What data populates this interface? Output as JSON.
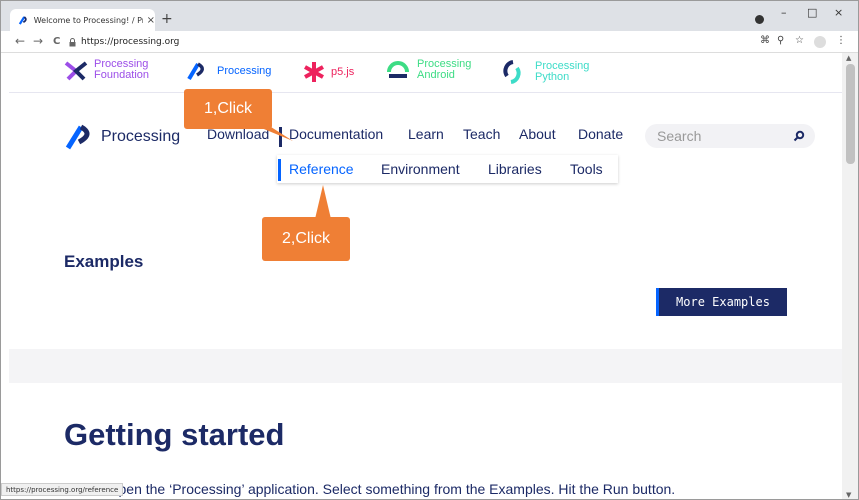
{
  "browser": {
    "tab_title": "Welcome to Processing! / Proce",
    "tab_close": "×",
    "new_tab": "+",
    "url": "https://processing.org",
    "back": "←",
    "forward": "→",
    "reload": "C",
    "minimize": "–",
    "maximize": "□",
    "close": "×",
    "status_url": "https://processing.org/reference"
  },
  "topnav": {
    "foundation": "Processing Foundation",
    "processing": "Processing",
    "p5js": "p5.js",
    "android": "Processing Android",
    "python": "Processing Python"
  },
  "header": {
    "logo_text": "Processing",
    "nav": [
      "Download",
      "Documentation",
      "Learn",
      "Teach",
      "About",
      "Donate"
    ],
    "search_placeholder": "Search"
  },
  "submenu": [
    "Reference",
    "Environment",
    "Libraries",
    "Tools"
  ],
  "examples": {
    "title": "Examples",
    "more_button": "More Examples"
  },
  "getting_started": {
    "title": "Getting started",
    "body": "ad and open the ‘Processing’ application. Select something from the Examples. Hit the Run button."
  },
  "callouts": {
    "step1": "1,Click",
    "step2": "2,Click"
  },
  "colors": {
    "brand_navy": "#1c2a66",
    "accent_blue": "#0564ff",
    "callout_orange": "#ef7f35",
    "p5_pink": "#ed225d",
    "android_green": "#3ddc84",
    "foundation_purple": "#9c4ee8"
  }
}
